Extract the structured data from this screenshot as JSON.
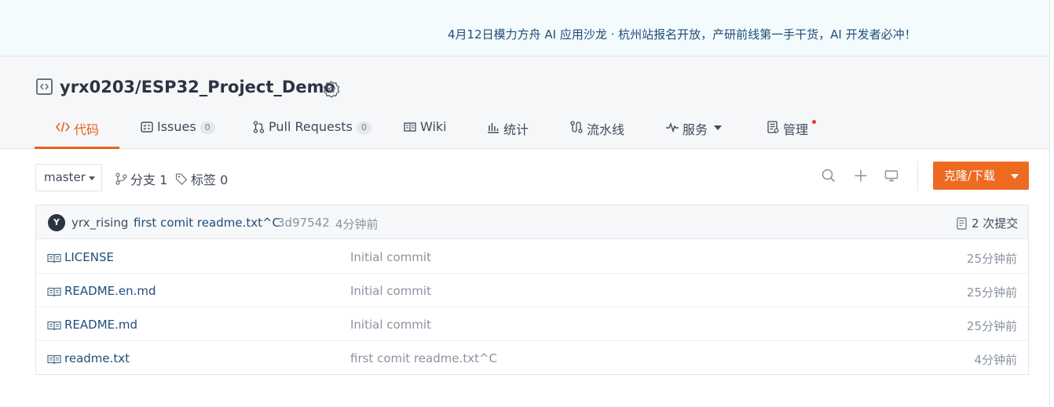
{
  "banner": {
    "text": "4月12日模力方舟 AI 应用沙龙 · 杭州站报名开放，产研前线第一手干货，AI 开发者必冲！"
  },
  "repo": {
    "title": "yrx0203/ESP32_Project_Demo"
  },
  "tabs": [
    {
      "label": "代码",
      "icon": "code-icon",
      "active": true
    },
    {
      "label": "Issues",
      "icon": "issues-icon",
      "badge": "0"
    },
    {
      "label": "Pull Requests",
      "icon": "pull-request-icon",
      "badge": "0"
    },
    {
      "label": "Wiki",
      "icon": "wiki-icon"
    },
    {
      "label": "统计",
      "icon": "chart-icon"
    },
    {
      "label": "流水线",
      "icon": "pipeline-icon"
    },
    {
      "label": "服务",
      "icon": "pulse-icon",
      "dropdown": true
    },
    {
      "label": "管理",
      "icon": "manage-icon",
      "notification": true
    }
  ],
  "toolbar": {
    "branch": "master",
    "branches_label": "分支 1",
    "tags_label": "标签 0",
    "clone_label": "克隆/下载",
    "icons": [
      "search-icon",
      "plus-icon",
      "monitor-icon"
    ]
  },
  "commit": {
    "avatar_letter": "Y",
    "author": "yrx_rising",
    "message": "first comit readme.txt^C",
    "sha": "3d97542",
    "time": "4分钟前",
    "count_label": "2 次提交"
  },
  "files": [
    {
      "name": "LICENSE",
      "commit": "Initial commit",
      "time": "25分钟前"
    },
    {
      "name": "README.en.md",
      "commit": "Initial commit",
      "time": "25分钟前"
    },
    {
      "name": "README.md",
      "commit": "Initial commit",
      "time": "25分钟前"
    },
    {
      "name": "readme.txt",
      "commit": "first comit readme.txt^C",
      "time": "4分钟前"
    }
  ],
  "colors": {
    "accent": "#ee6a21",
    "link": "#1e4d78",
    "muted": "#8a93a0",
    "notification": "#e8382c"
  }
}
